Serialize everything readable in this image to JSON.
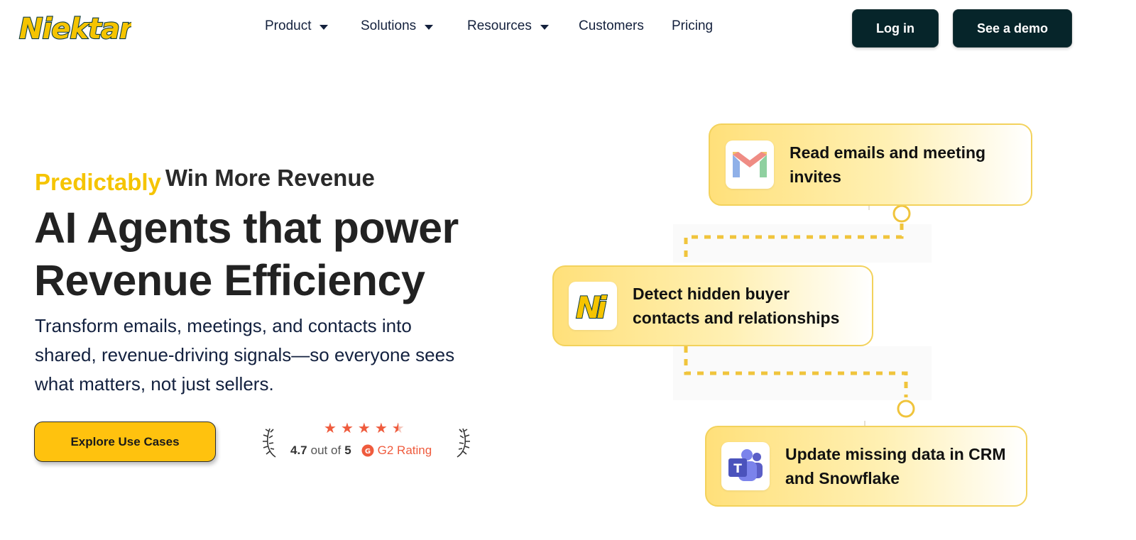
{
  "brand": {
    "logo_text": "Niektar",
    "logo_color": "#f5c400",
    "logo_outline": "#0d3b44"
  },
  "nav": {
    "items": [
      {
        "label": "Product",
        "dropdown": true
      },
      {
        "label": "Solutions",
        "dropdown": true
      },
      {
        "label": "Resources",
        "dropdown": true
      },
      {
        "label": "Customers",
        "dropdown": false
      },
      {
        "label": "Pricing",
        "dropdown": false
      }
    ],
    "login_label": "Log in",
    "demo_label": "See a demo"
  },
  "hero": {
    "eyebrow_highlight": "Predictably",
    "eyebrow_rest": "Win More Revenue",
    "headline_line1": "AI Agents that power",
    "headline_line2": "Revenue Efficiency",
    "subtext": "Transform emails, meetings, and contacts into shared, revenue-driving signals—so everyone sees what matters, not just sellers.",
    "cta_label": "Explore Use Cases"
  },
  "rating": {
    "stars": 4.5,
    "score": "4.7",
    "out_of_text": "out of",
    "max": "5",
    "source_label": "G2 Rating"
  },
  "workflow": {
    "steps": [
      {
        "icon": "gmail-icon",
        "text": "Read emails and meeting invites"
      },
      {
        "icon": "niektar-ai-icon",
        "text": "Detect hidden buyer contacts and relationships"
      },
      {
        "icon": "microsoft-teams-icon",
        "text": "Update missing data in CRM and Snowflake"
      }
    ]
  },
  "colors": {
    "accent_yellow": "#ffc20e",
    "dark_button": "#06252a",
    "heading_text": "#222222",
    "g2_red": "#ef5b3d"
  }
}
